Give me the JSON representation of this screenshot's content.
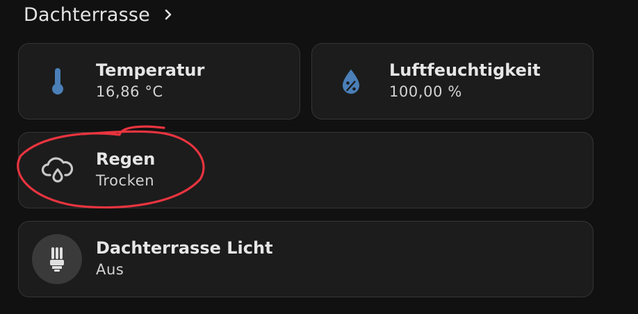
{
  "header": {
    "title": "Dachterrasse",
    "chevron_icon": "chevron-right-icon"
  },
  "cards": {
    "temperature": {
      "name": "Temperatur",
      "state": "16,86 °C",
      "icon": "thermometer-icon",
      "icon_color": "#4a7fb8"
    },
    "humidity": {
      "name": "Luftfeuchtigkeit",
      "state": "100,00 %",
      "icon": "water-percent-icon",
      "icon_color": "#4a7fb8"
    },
    "rain": {
      "name": "Regen",
      "state": "Trocken",
      "icon": "weather-rain-icon",
      "icon_color": "#c8c8c8"
    },
    "light": {
      "name": "Dachterrasse Licht",
      "state": "Aus",
      "icon": "lightbulb-cfl-icon",
      "icon_color": "#e0e0e0"
    }
  },
  "colors": {
    "background": "#111111",
    "card": "#1c1c1c",
    "card_border": "#353535",
    "annotation": "#e8343f"
  }
}
